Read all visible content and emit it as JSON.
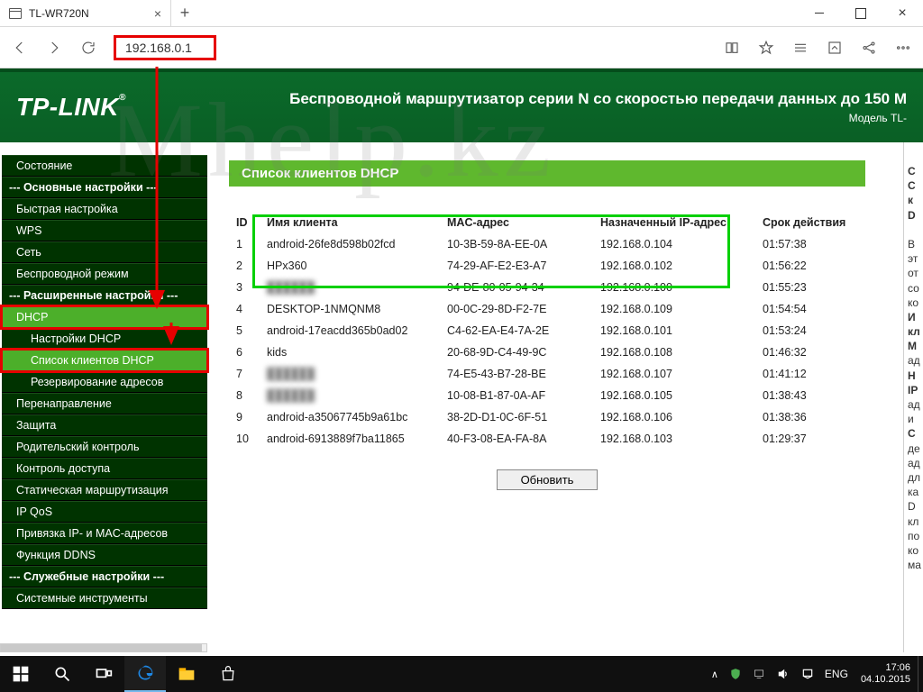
{
  "browser": {
    "tab_title": "TL-WR720N",
    "url": "192.168.0.1"
  },
  "banner": {
    "brand": "TP-LINK",
    "desc": "Беспроводной маршрутизатор серии N со скоростью передачи данных до 150 М",
    "model": "Модель TL-"
  },
  "nav": {
    "status": "Состояние",
    "basic_header": "--- Основные настройки ---",
    "quick": "Быстрая настройка",
    "wps": "WPS",
    "network": "Сеть",
    "wireless": "Беспроводной режим",
    "adv_header": "--- Расширенные настройки ---",
    "dhcp": "DHCP",
    "dhcp_settings": "Настройки DHCP",
    "dhcp_clients": "Список клиентов DHCP",
    "dhcp_reserve": "Резервирование адресов",
    "forward": "Перенаправление",
    "security": "Защита",
    "parental": "Родительский контроль",
    "access": "Контроль доступа",
    "static_route": "Статическая маршрутизация",
    "ipqos": "IP QoS",
    "binding": "Привязка IP- и MAC-адресов",
    "ddns": "Функция DDNS",
    "svc_header": "--- Служебные настройки ---",
    "systools": "Системные инструменты"
  },
  "page": {
    "title": "Список клиентов DHCP",
    "columns": {
      "id": "ID",
      "name": "Имя клиента",
      "mac": "MAC-адрес",
      "ip": "Назначенный IP-адрес",
      "lease": "Срок действия"
    },
    "rows": [
      {
        "id": "1",
        "name": "android-26fe8d598b02fcd",
        "mac": "10-3B-59-8A-EE-0A",
        "ip": "192.168.0.104",
        "lease": "01:57:38"
      },
      {
        "id": "2",
        "name": "HPx360",
        "mac": "74-29-AF-E2-E3-A7",
        "ip": "192.168.0.102",
        "lease": "01:56:22"
      },
      {
        "id": "3",
        "name": "hidden",
        "mac": "94-DE-80-05-94-34",
        "ip": "192.168.0.100",
        "lease": "01:55:23"
      },
      {
        "id": "4",
        "name": "DESKTOP-1NMQNM8",
        "mac": "00-0C-29-8D-F2-7E",
        "ip": "192.168.0.109",
        "lease": "01:54:54"
      },
      {
        "id": "5",
        "name": "android-17eacdd365b0ad02",
        "mac": "C4-62-EA-E4-7A-2E",
        "ip": "192.168.0.101",
        "lease": "01:53:24"
      },
      {
        "id": "6",
        "name": "kids",
        "mac": "20-68-9D-C4-49-9C",
        "ip": "192.168.0.108",
        "lease": "01:46:32"
      },
      {
        "id": "7",
        "name": "hidden",
        "mac": "74-E5-43-B7-28-BE",
        "ip": "192.168.0.107",
        "lease": "01:41:12"
      },
      {
        "id": "8",
        "name": "hidden",
        "mac": "10-08-B1-87-0A-AF",
        "ip": "192.168.0.105",
        "lease": "01:38:43"
      },
      {
        "id": "9",
        "name": "android-a35067745b9a61bc",
        "mac": "38-2D-D1-0C-6F-51",
        "ip": "192.168.0.106",
        "lease": "01:38:36"
      },
      {
        "id": "10",
        "name": "android-6913889f7ba11865",
        "mac": "40-F3-08-EA-FA-8A",
        "ip": "192.168.0.103",
        "lease": "01:29:37"
      }
    ],
    "refresh": "Обновить"
  },
  "taskbar": {
    "lang": "ENG",
    "time": "17:06",
    "date": "04.10.2015"
  },
  "watermark": "Mhelp.kz"
}
